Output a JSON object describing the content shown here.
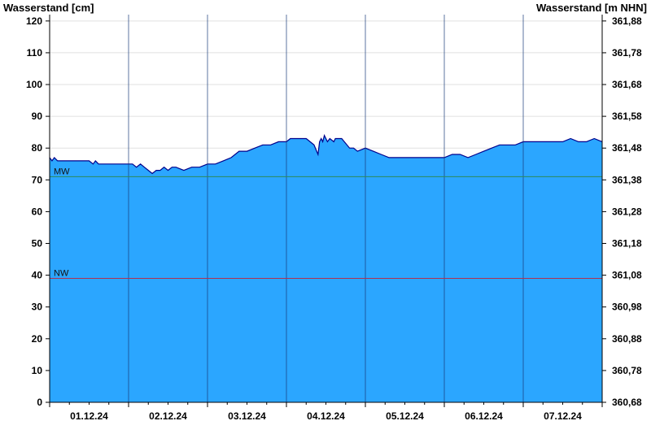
{
  "chart_data": {
    "type": "area",
    "ylabel_left": "Wasserstand [cm]",
    "ylabel_right": "Wasserstand [m NHN]",
    "ylim": [
      0,
      122
    ],
    "yticks_left": [
      "0",
      "10",
      "20",
      "30",
      "40",
      "50",
      "60",
      "70",
      "80",
      "90",
      "100",
      "110",
      "120"
    ],
    "yticks_right": [
      "360,68",
      "360,78",
      "360,88",
      "360,98",
      "361,08",
      "361,18",
      "361,28",
      "361,38",
      "361,48",
      "361,58",
      "361,68",
      "361,78",
      "361,88"
    ],
    "x_categories": [
      "01.12.24",
      "02.12.24",
      "03.12.24",
      "04.12.24",
      "05.12.24",
      "06.12.24",
      "07.12.24"
    ],
    "xlim_days": [
      0,
      7
    ],
    "reference_lines": [
      {
        "label": "MW",
        "value": 71,
        "color": "#2e8b57"
      },
      {
        "label": "NW",
        "value": 39,
        "color": "#b03050"
      }
    ],
    "grid": true,
    "fill_color": "#2ba6ff",
    "line_color": "#00008b",
    "series": [
      {
        "x": [
          0,
          0.03,
          0.06,
          0.1,
          0.15,
          0.2,
          0.3,
          0.4,
          0.5,
          0.55,
          0.58,
          0.62,
          0.7,
          0.8,
          0.9,
          1.0,
          1.05,
          1.1,
          1.15,
          1.2,
          1.25,
          1.3,
          1.35,
          1.4,
          1.45,
          1.5,
          1.55,
          1.6,
          1.7,
          1.8,
          1.9,
          2.0,
          2.1,
          2.2,
          2.3,
          2.4,
          2.5,
          2.6,
          2.7,
          2.8,
          2.9,
          3.0,
          3.05,
          3.1,
          3.15,
          3.2,
          3.25,
          3.3,
          3.35,
          3.4,
          3.42,
          3.44,
          3.46,
          3.48,
          3.5,
          3.52,
          3.55,
          3.6,
          3.62,
          3.7,
          3.8,
          3.85,
          3.9,
          4.0,
          4.1,
          4.2,
          4.3,
          4.4,
          4.5,
          4.6,
          4.7,
          4.8,
          4.9,
          5.0,
          5.1,
          5.2,
          5.3,
          5.4,
          5.5,
          5.6,
          5.7,
          5.8,
          5.9,
          6.0,
          6.1,
          6.2,
          6.3,
          6.4,
          6.5,
          6.6,
          6.7,
          6.8,
          6.9,
          7.0
        ],
        "y": [
          77,
          76,
          77,
          76,
          76,
          76,
          76,
          76,
          76,
          75,
          76,
          75,
          75,
          75,
          75,
          75,
          75,
          74,
          75,
          74,
          73,
          72,
          73,
          73,
          74,
          73,
          74,
          74,
          73,
          74,
          74,
          75,
          75,
          76,
          77,
          79,
          79,
          80,
          81,
          81,
          82,
          82,
          83,
          83,
          83,
          83,
          83,
          82,
          81,
          78,
          82,
          83,
          82,
          84,
          83,
          82,
          83,
          82,
          83,
          83,
          80,
          80,
          79,
          80,
          79,
          78,
          77,
          77,
          77,
          77,
          77,
          77,
          77,
          77,
          78,
          78,
          77,
          78,
          79,
          80,
          81,
          81,
          81,
          82,
          82,
          82,
          82,
          82,
          82,
          83,
          82,
          82,
          83,
          82
        ]
      }
    ]
  }
}
